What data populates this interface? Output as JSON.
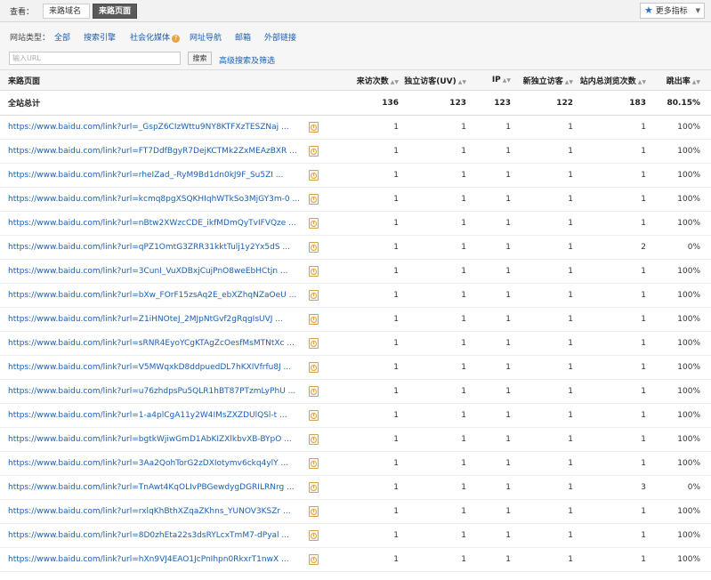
{
  "top": {
    "view_label": "查看：",
    "tab_domain": "来路域名",
    "tab_page": "来路页面",
    "metrics_label": "更多指标"
  },
  "filter": {
    "type_label": "网站类型：",
    "types": [
      "全部",
      "搜索引擎",
      "社会化媒体",
      "网址导航",
      "邮箱",
      "外部链接"
    ],
    "input_placeholder": "输入URL",
    "search_label": "搜索",
    "advanced_label": "高级搜索及筛选"
  },
  "table": {
    "headers": [
      "来路页面",
      "来访次数",
      "独立访客(UV)",
      "IP",
      "新独立访客",
      "站内总浏览次数",
      "跳出率"
    ],
    "total": {
      "label": "全站总计",
      "values": [
        "136",
        "123",
        "123",
        "122",
        "183",
        "80.15%"
      ]
    },
    "rows": [
      {
        "url": "https://www.baidu.com/link?url=_GspZ6CIzWttu9NY8KTFXzTESZNaj ...",
        "values": [
          "1",
          "1",
          "1",
          "1",
          "1",
          "100%"
        ]
      },
      {
        "url": "https://www.baidu.com/link?url=FT7DdfBgyR7DejKCTMk2ZxMEAzBXR ...",
        "values": [
          "1",
          "1",
          "1",
          "1",
          "1",
          "100%"
        ]
      },
      {
        "url": "https://www.baidu.com/link?url=rheIZad_-RyM9Bd1dn0kJ9F_Su5ZI ...",
        "values": [
          "1",
          "1",
          "1",
          "1",
          "1",
          "100%"
        ]
      },
      {
        "url": "https://www.baidu.com/link?url=kcmq8pgXSQKHIqhWTkSo3MjGY3m-0 ...",
        "values": [
          "1",
          "1",
          "1",
          "1",
          "1",
          "100%"
        ]
      },
      {
        "url": "https://www.baidu.com/link?url=nBtw2XWzcCDE_ikfMDmQyTvIFVQze ...",
        "values": [
          "1",
          "1",
          "1",
          "1",
          "1",
          "100%"
        ]
      },
      {
        "url": "https://www.baidu.com/link?url=qPZ1OmtG3ZRR31kktTulj1y2Yx5dS ...",
        "values": [
          "1",
          "1",
          "1",
          "1",
          "2",
          "0%"
        ]
      },
      {
        "url": "https://www.baidu.com/link?url=3CunI_VuXDBxjCujPnO8weEbHCtjn ...",
        "values": [
          "1",
          "1",
          "1",
          "1",
          "1",
          "100%"
        ]
      },
      {
        "url": "https://www.baidu.com/link?url=bXw_FOrF15zsAq2E_ebXZhqNZaOeU ...",
        "values": [
          "1",
          "1",
          "1",
          "1",
          "1",
          "100%"
        ]
      },
      {
        "url": "https://www.baidu.com/link?url=Z1iHNOteJ_2MJpNtGvf2gRqgIsUVJ ...",
        "values": [
          "1",
          "1",
          "1",
          "1",
          "1",
          "100%"
        ]
      },
      {
        "url": "https://www.baidu.com/link?url=sRNR4EyoYCgKTAgZcOesfMsMTNtXc ...",
        "values": [
          "1",
          "1",
          "1",
          "1",
          "1",
          "100%"
        ]
      },
      {
        "url": "https://www.baidu.com/link?url=V5MWqxkD8ddpuedDL7hKXIVfrfu8J ...",
        "values": [
          "1",
          "1",
          "1",
          "1",
          "1",
          "100%"
        ]
      },
      {
        "url": "https://www.baidu.com/link?url=u76zhdpsPu5QLR1hBT87PTzmLyPhU ...",
        "values": [
          "1",
          "1",
          "1",
          "1",
          "1",
          "100%"
        ]
      },
      {
        "url": "https://www.baidu.com/link?url=1-a4plCgA11y2W4IMsZXZDUlQSl-t ...",
        "values": [
          "1",
          "1",
          "1",
          "1",
          "1",
          "100%"
        ]
      },
      {
        "url": "https://www.baidu.com/link?url=bgtkWjiwGmD1AbKIZXlkbvXB-BYpO ...",
        "values": [
          "1",
          "1",
          "1",
          "1",
          "1",
          "100%"
        ]
      },
      {
        "url": "https://www.baidu.com/link?url=3Aa2QohTorG2zDXIotymv6ckq4ylY ...",
        "values": [
          "1",
          "1",
          "1",
          "1",
          "1",
          "100%"
        ]
      },
      {
        "url": "https://www.baidu.com/link?url=TnAwt4KqOLIvPBGewdygDGRILRNrg ...",
        "values": [
          "1",
          "1",
          "1",
          "1",
          "3",
          "0%"
        ]
      },
      {
        "url": "https://www.baidu.com/link?url=rxlqKhBthXZqaZKhns_YUNOV3KSZr ...",
        "values": [
          "1",
          "1",
          "1",
          "1",
          "1",
          "100%"
        ]
      },
      {
        "url": "https://www.baidu.com/link?url=8D0zhEta22s3dsRYLcxTmM7-dPyal ...",
        "values": [
          "1",
          "1",
          "1",
          "1",
          "1",
          "100%"
        ]
      },
      {
        "url": "https://www.baidu.com/link?url=hXn9VJ4EAO1JcPnIhpn0RkxrT1nwX ...",
        "values": [
          "1",
          "1",
          "1",
          "1",
          "1",
          "100%"
        ]
      }
    ]
  }
}
